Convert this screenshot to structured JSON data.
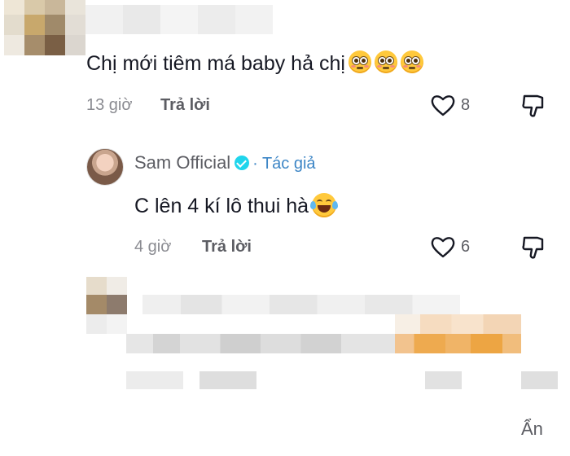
{
  "comment1": {
    "text": "Chị mới tiêm má baby hả chị",
    "emojis": [
      "flushed-face",
      "flushed-face",
      "flushed-face"
    ],
    "time": "13 giờ",
    "reply_label": "Trả lời",
    "like_count": "8"
  },
  "reply1": {
    "author": "Sam Official",
    "author_tag": "· Tác giả",
    "text": "C lên 4 kí lô thui hà",
    "emoji": "face-with-tears-of-joy",
    "time": "4 giờ",
    "reply_label": "Trả lời",
    "like_count": "6"
  },
  "footer": {
    "hide_label": "Ẩn"
  },
  "colors": {
    "text": "#161823",
    "muted": "#8a8b91",
    "verified": "#20d5ec",
    "author_tag": "#3d86c6"
  }
}
